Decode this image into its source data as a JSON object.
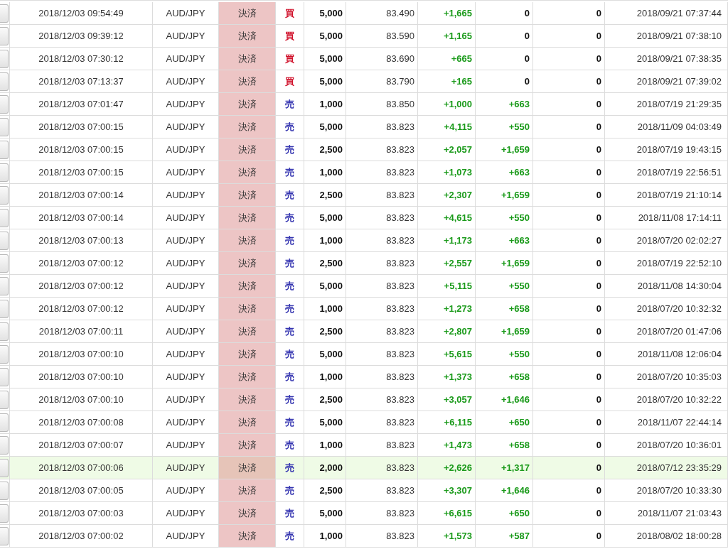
{
  "rows": [
    {
      "selected": false,
      "time": "2018/12/03 09:54:49",
      "pair": "AUD/JPY",
      "type": "決済",
      "side": {
        "text": "買",
        "color": "#d0102a"
      },
      "quantity": "5,000",
      "price": "83.490",
      "column_7": "+1,665",
      "column_8": {
        "text": "0",
        "color": "#111111"
      },
      "column_9": "0",
      "close_time": "2018/09/21 07:37:44"
    },
    {
      "selected": false,
      "time": "2018/12/03 09:39:12",
      "pair": "AUD/JPY",
      "type": "決済",
      "side": {
        "text": "買",
        "color": "#d0102a"
      },
      "quantity": "5,000",
      "price": "83.590",
      "column_7": "+1,165",
      "column_8": {
        "text": "0",
        "color": "#111111"
      },
      "column_9": "0",
      "close_time": "2018/09/21 07:38:10"
    },
    {
      "selected": false,
      "time": "2018/12/03 07:30:12",
      "pair": "AUD/JPY",
      "type": "決済",
      "side": {
        "text": "買",
        "color": "#d0102a"
      },
      "quantity": "5,000",
      "price": "83.690",
      "column_7": "+665",
      "column_8": {
        "text": "0",
        "color": "#111111"
      },
      "column_9": "0",
      "close_time": "2018/09/21 07:38:35"
    },
    {
      "selected": false,
      "time": "2018/12/03 07:13:37",
      "pair": "AUD/JPY",
      "type": "決済",
      "side": {
        "text": "買",
        "color": "#d0102a"
      },
      "quantity": "5,000",
      "price": "83.790",
      "column_7": "+165",
      "column_8": {
        "text": "0",
        "color": "#111111"
      },
      "column_9": "0",
      "close_time": "2018/09/21 07:39:02"
    },
    {
      "selected": false,
      "time": "2018/12/03 07:01:47",
      "pair": "AUD/JPY",
      "type": "決済",
      "side": {
        "text": "売",
        "color": "#3434b0"
      },
      "quantity": "1,000",
      "price": "83.850",
      "column_7": "+1,000",
      "column_8": {
        "text": "+663",
        "color": "#1a9a1a"
      },
      "column_9": "0",
      "close_time": "2018/07/19 21:29:35"
    },
    {
      "selected": false,
      "time": "2018/12/03 07:00:15",
      "pair": "AUD/JPY",
      "type": "決済",
      "side": {
        "text": "売",
        "color": "#3434b0"
      },
      "quantity": "5,000",
      "price": "83.823",
      "column_7": "+4,115",
      "column_8": {
        "text": "+550",
        "color": "#1a9a1a"
      },
      "column_9": "0",
      "close_time": "2018/11/09 04:03:49"
    },
    {
      "selected": false,
      "time": "2018/12/03 07:00:15",
      "pair": "AUD/JPY",
      "type": "決済",
      "side": {
        "text": "売",
        "color": "#3434b0"
      },
      "quantity": "2,500",
      "price": "83.823",
      "column_7": "+2,057",
      "column_8": {
        "text": "+1,659",
        "color": "#1a9a1a"
      },
      "column_9": "0",
      "close_time": "2018/07/19 19:43:15"
    },
    {
      "selected": false,
      "time": "2018/12/03 07:00:15",
      "pair": "AUD/JPY",
      "type": "決済",
      "side": {
        "text": "売",
        "color": "#3434b0"
      },
      "quantity": "1,000",
      "price": "83.823",
      "column_7": "+1,073",
      "column_8": {
        "text": "+663",
        "color": "#1a9a1a"
      },
      "column_9": "0",
      "close_time": "2018/07/19 22:56:51"
    },
    {
      "selected": false,
      "time": "2018/12/03 07:00:14",
      "pair": "AUD/JPY",
      "type": "決済",
      "side": {
        "text": "売",
        "color": "#3434b0"
      },
      "quantity": "2,500",
      "price": "83.823",
      "column_7": "+2,307",
      "column_8": {
        "text": "+1,659",
        "color": "#1a9a1a"
      },
      "column_9": "0",
      "close_time": "2018/07/19 21:10:14"
    },
    {
      "selected": false,
      "time": "2018/12/03 07:00:14",
      "pair": "AUD/JPY",
      "type": "決済",
      "side": {
        "text": "売",
        "color": "#3434b0"
      },
      "quantity": "5,000",
      "price": "83.823",
      "column_7": "+4,615",
      "column_8": {
        "text": "+550",
        "color": "#1a9a1a"
      },
      "column_9": "0",
      "close_time": "2018/11/08 17:14:11"
    },
    {
      "selected": false,
      "time": "2018/12/03 07:00:13",
      "pair": "AUD/JPY",
      "type": "決済",
      "side": {
        "text": "売",
        "color": "#3434b0"
      },
      "quantity": "1,000",
      "price": "83.823",
      "column_7": "+1,173",
      "column_8": {
        "text": "+663",
        "color": "#1a9a1a"
      },
      "column_9": "0",
      "close_time": "2018/07/20 02:02:27"
    },
    {
      "selected": false,
      "time": "2018/12/03 07:00:12",
      "pair": "AUD/JPY",
      "type": "決済",
      "side": {
        "text": "売",
        "color": "#3434b0"
      },
      "quantity": "2,500",
      "price": "83.823",
      "column_7": "+2,557",
      "column_8": {
        "text": "+1,659",
        "color": "#1a9a1a"
      },
      "column_9": "0",
      "close_time": "2018/07/19 22:52:10"
    },
    {
      "selected": false,
      "time": "2018/12/03 07:00:12",
      "pair": "AUD/JPY",
      "type": "決済",
      "side": {
        "text": "売",
        "color": "#3434b0"
      },
      "quantity": "5,000",
      "price": "83.823",
      "column_7": "+5,115",
      "column_8": {
        "text": "+550",
        "color": "#1a9a1a"
      },
      "column_9": "0",
      "close_time": "2018/11/08 14:30:04"
    },
    {
      "selected": false,
      "time": "2018/12/03 07:00:12",
      "pair": "AUD/JPY",
      "type": "決済",
      "side": {
        "text": "売",
        "color": "#3434b0"
      },
      "quantity": "1,000",
      "price": "83.823",
      "column_7": "+1,273",
      "column_8": {
        "text": "+658",
        "color": "#1a9a1a"
      },
      "column_9": "0",
      "close_time": "2018/07/20 10:32:32"
    },
    {
      "selected": false,
      "time": "2018/12/03 07:00:11",
      "pair": "AUD/JPY",
      "type": "決済",
      "side": {
        "text": "売",
        "color": "#3434b0"
      },
      "quantity": "2,500",
      "price": "83.823",
      "column_7": "+2,807",
      "column_8": {
        "text": "+1,659",
        "color": "#1a9a1a"
      },
      "column_9": "0",
      "close_time": "2018/07/20 01:47:06"
    },
    {
      "selected": false,
      "time": "2018/12/03 07:00:10",
      "pair": "AUD/JPY",
      "type": "決済",
      "side": {
        "text": "売",
        "color": "#3434b0"
      },
      "quantity": "5,000",
      "price": "83.823",
      "column_7": "+5,615",
      "column_8": {
        "text": "+550",
        "color": "#1a9a1a"
      },
      "column_9": "0",
      "close_time": "2018/11/08 12:06:04"
    },
    {
      "selected": false,
      "time": "2018/12/03 07:00:10",
      "pair": "AUD/JPY",
      "type": "決済",
      "side": {
        "text": "売",
        "color": "#3434b0"
      },
      "quantity": "1,000",
      "price": "83.823",
      "column_7": "+1,373",
      "column_8": {
        "text": "+658",
        "color": "#1a9a1a"
      },
      "column_9": "0",
      "close_time": "2018/07/20 10:35:03"
    },
    {
      "selected": false,
      "time": "2018/12/03 07:00:10",
      "pair": "AUD/JPY",
      "type": "決済",
      "side": {
        "text": "売",
        "color": "#3434b0"
      },
      "quantity": "2,500",
      "price": "83.823",
      "column_7": "+3,057",
      "column_8": {
        "text": "+1,646",
        "color": "#1a9a1a"
      },
      "column_9": "0",
      "close_time": "2018/07/20 10:32:22"
    },
    {
      "selected": false,
      "time": "2018/12/03 07:00:08",
      "pair": "AUD/JPY",
      "type": "決済",
      "side": {
        "text": "売",
        "color": "#3434b0"
      },
      "quantity": "5,000",
      "price": "83.823",
      "column_7": "+6,115",
      "column_8": {
        "text": "+650",
        "color": "#1a9a1a"
      },
      "column_9": "0",
      "close_time": "2018/11/07 22:44:14"
    },
    {
      "selected": false,
      "time": "2018/12/03 07:00:07",
      "pair": "AUD/JPY",
      "type": "決済",
      "side": {
        "text": "売",
        "color": "#3434b0"
      },
      "quantity": "1,000",
      "price": "83.823",
      "column_7": "+1,473",
      "column_8": {
        "text": "+658",
        "color": "#1a9a1a"
      },
      "column_9": "0",
      "close_time": "2018/07/20 10:36:01"
    },
    {
      "selected": true,
      "time": "2018/12/03 07:00:06",
      "pair": "AUD/JPY",
      "type": "決済",
      "side": {
        "text": "売",
        "color": "#3434b0"
      },
      "quantity": "2,000",
      "price": "83.823",
      "column_7": "+2,626",
      "column_8": {
        "text": "+1,317",
        "color": "#1a9a1a"
      },
      "column_9": "0",
      "close_time": "2018/07/12 23:35:29"
    },
    {
      "selected": false,
      "time": "2018/12/03 07:00:05",
      "pair": "AUD/JPY",
      "type": "決済",
      "side": {
        "text": "売",
        "color": "#3434b0"
      },
      "quantity": "2,500",
      "price": "83.823",
      "column_7": "+3,307",
      "column_8": {
        "text": "+1,646",
        "color": "#1a9a1a"
      },
      "column_9": "0",
      "close_time": "2018/07/20 10:33:30"
    },
    {
      "selected": false,
      "time": "2018/12/03 07:00:03",
      "pair": "AUD/JPY",
      "type": "決済",
      "side": {
        "text": "売",
        "color": "#3434b0"
      },
      "quantity": "5,000",
      "price": "83.823",
      "column_7": "+6,615",
      "column_8": {
        "text": "+650",
        "color": "#1a9a1a"
      },
      "column_9": "0",
      "close_time": "2018/11/07 21:03:43"
    },
    {
      "selected": false,
      "time": "2018/12/03 07:00:02",
      "pair": "AUD/JPY",
      "type": "決済",
      "side": {
        "text": "売",
        "color": "#3434b0"
      },
      "quantity": "1,000",
      "price": "83.823",
      "column_7": "+1,573",
      "column_8": {
        "text": "+587",
        "color": "#1a9a1a"
      },
      "column_9": "0",
      "close_time": "2018/08/02 18:00:28"
    }
  ]
}
